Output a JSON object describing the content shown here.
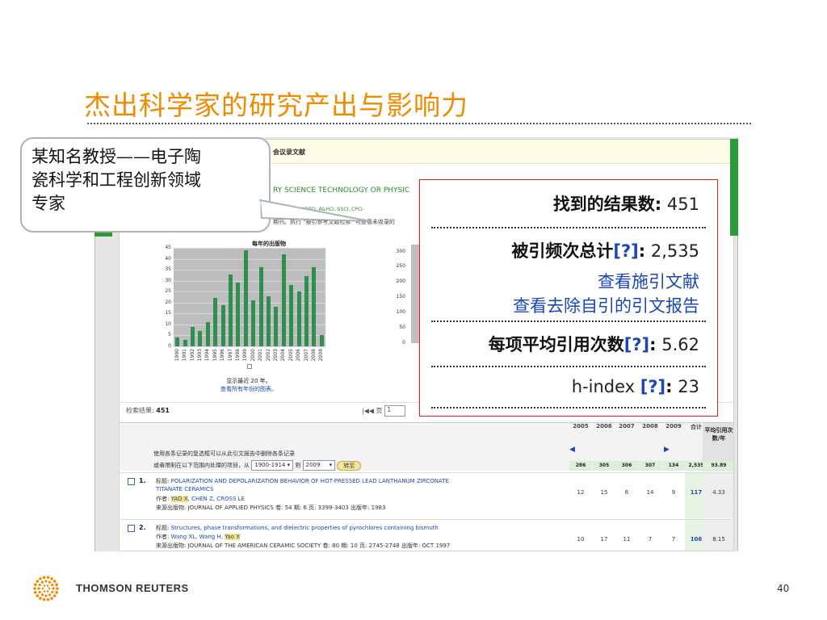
{
  "slide": {
    "title": "杰出科学家的研究产出与影响力",
    "page_number": "40"
  },
  "callout": {
    "line1": "某知名教授——电子陶",
    "line2": "瓷科学和工程创新领域",
    "line3": "专家"
  },
  "report": {
    "header": "会议录文献",
    "query": "RY SCIENCE TECHNOLOGY OR PHYSIC",
    "databases": "EXPANDED, A&HCI, SSCI, CPCI-",
    "note": "期刊。执行 \"被引参考文献检索\" 可查看未收录的",
    "chart_title": "每年的出版物",
    "show_recent": "显示最近 20 年。",
    "show_all": "查看所有年份的图表。",
    "results_label": "检索结果:",
    "results_count": "451",
    "pager_label": "页",
    "pager_value": "1",
    "instruction1": "使用各条记录的复选框可以从此引文报告中删除各条记录",
    "instruction2": "或者限制在以下范围内处理的项目，从",
    "range_from": "1900-1914",
    "range_to_label": "到",
    "range_to": "2009",
    "go_button": "转至",
    "avg_header": "平均引用次数/年"
  },
  "table": {
    "years": [
      "2005",
      "2006",
      "2007",
      "2008",
      "2009",
      "合计"
    ],
    "totals": [
      "286",
      "305",
      "306",
      "307",
      "134",
      "2,535",
      "93.89"
    ],
    "records": [
      {
        "num": "1.",
        "title_label": "标题:",
        "title": "POLARIZATION AND DEPOLARIZATION BEHAVIOR OF HOT-PRESSED LEAD LANTHANUM ZIRCONATE",
        "title_cont": "TITANATE CERAMICS",
        "author_label": "作者:",
        "author_hl": "YAO X",
        "authors_rest": ", CHEN Z, CROSS LE",
        "source": "来源出版物: JOURNAL OF APPLIED PHYSICS  卷: 54  期: 6  页: 3399-3403  出版年: 1983",
        "cells": [
          "12",
          "15",
          "6",
          "14",
          "9",
          "117",
          "4.33"
        ]
      },
      {
        "num": "2.",
        "title_label": "标题:",
        "title": "Structures, phase transformations, and dielectric properties of pyrochlores containing bismuth",
        "author_label": "作者:",
        "authors_pre": "Wang XL, Wang H, ",
        "author_hl": "Yao X",
        "source": "来源出版物: JOURNAL OF THE AMERICAN CERAMIC SOCIETY  卷: 80  期: 10  页: 2745-2748  出版年: OCT 1997",
        "cells": [
          "10",
          "17",
          "11",
          "7",
          "7",
          "106",
          "8.15"
        ]
      }
    ]
  },
  "summary": {
    "found_label": "找到的结果数:",
    "found_value": "451",
    "cited_label": "被引频次总计",
    "cited_q": "[?]",
    "cited_value": "2,535",
    "link_citing": "查看施引文献",
    "link_no_self": "查看去除自引的引文报告",
    "avg_label": "每项平均引用次数",
    "avg_q": "[?]",
    "avg_value": "5.62",
    "h_label": "h-index",
    "h_q": "[?]",
    "h_value": "23"
  },
  "footer": {
    "brand": "THOMSON REUTERS"
  },
  "chart_data": {
    "type": "bar",
    "title": "每年的出版物",
    "categories": [
      "1990",
      "1991",
      "1992",
      "1993",
      "1994",
      "1995",
      "1996",
      "1997",
      "1998",
      "1999",
      "2000",
      "2001",
      "2002",
      "2003",
      "2004",
      "2005",
      "2006",
      "2007",
      "2008",
      "2009"
    ],
    "values": [
      4,
      3,
      9,
      7,
      11,
      22,
      19,
      33,
      29,
      44,
      21,
      36,
      23,
      18,
      42,
      28,
      25,
      32,
      36,
      5
    ],
    "ylim": [
      0,
      45
    ],
    "yticks": [
      "0",
      "5",
      "10",
      "15",
      "20",
      "25",
      "30",
      "35",
      "40",
      "45"
    ],
    "second_chart_yticks": [
      "0",
      "50",
      "100",
      "150",
      "200",
      "250",
      "300"
    ]
  },
  "colors": {
    "title": "#f08a00",
    "bar": "#2f8f4f",
    "link": "#1a47b8",
    "summary_border": "#dd2211"
  }
}
